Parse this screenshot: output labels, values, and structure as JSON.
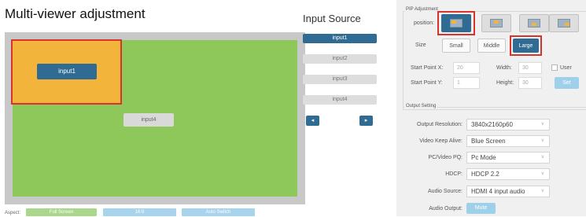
{
  "left": {
    "title": "Multi-viewer adjustment",
    "windows": {
      "input1": "input1",
      "input4": "input4"
    },
    "aspect": {
      "label": "Aspect:",
      "buttons": [
        "Full Screen",
        "16:9",
        "Auto Switch"
      ]
    }
  },
  "source": {
    "title": "Input Source",
    "items": [
      "input1",
      "input2",
      "input3",
      "input4"
    ],
    "prev": "◂",
    "next": "▸"
  },
  "pip": {
    "legend": "PIP Adjustment",
    "position_label": "position:",
    "positions": [
      "top-left",
      "top-center",
      "bottom-center",
      "bottom-right"
    ],
    "size_label": "Size",
    "sizes": [
      "Small",
      "Middle",
      "Large"
    ],
    "start_x_label": "Start Point X:",
    "start_x": "20",
    "start_y_label": "Start Point Y:",
    "start_y": "1",
    "width_label": "Width:",
    "width": "30",
    "height_label": "Height:",
    "height": "30",
    "user_label": "User",
    "set_label": "Set"
  },
  "output": {
    "legend": "Output Setting",
    "rows": [
      {
        "label": "Output Resolution:",
        "value": "3840x2160p60"
      },
      {
        "label": "Video Keep Alive:",
        "value": "Blue Screen"
      },
      {
        "label": "PC/Video PQ:",
        "value": "Pc Mode"
      },
      {
        "label": "HDCP:",
        "value": "HDCP 2.2"
      },
      {
        "label": "Audio Source:",
        "value": "HDMI 4 input audio"
      }
    ],
    "audio_output_label": "Audio Output:",
    "mute_label": "Mute"
  },
  "colors": {
    "accent": "#2f6b93",
    "canvas_green": "#8fc85a",
    "window_orange": "#f3b43c",
    "highlight_red": "#d9342b",
    "light_button": "#9fd0ea"
  }
}
